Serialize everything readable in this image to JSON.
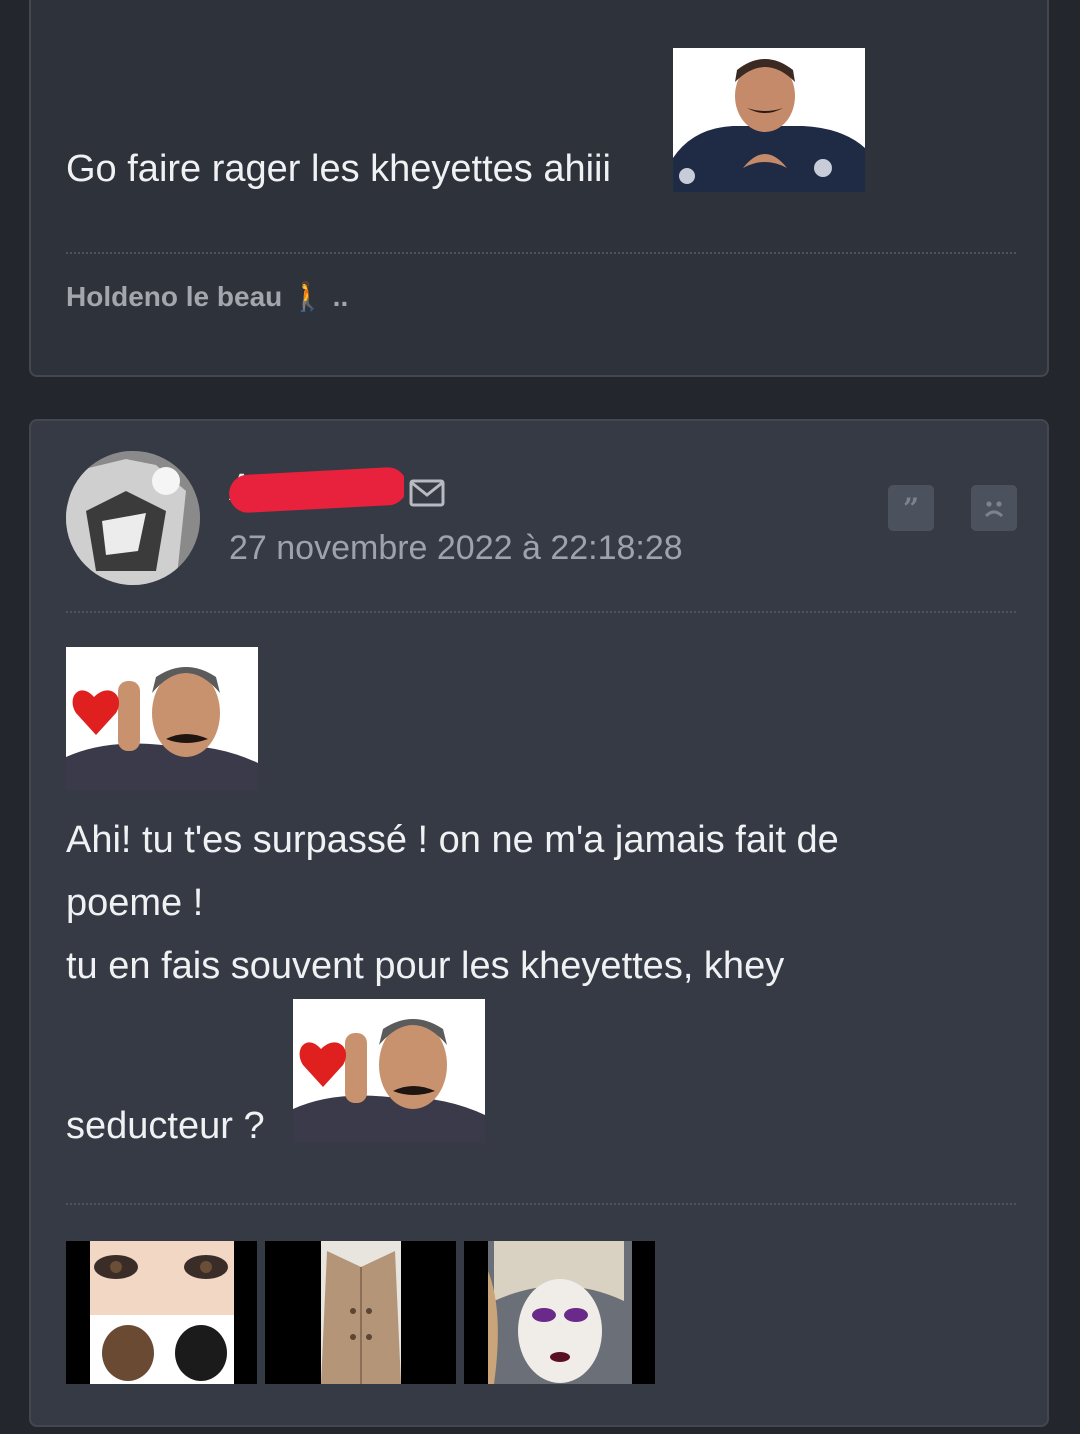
{
  "previous_post": {
    "text": "Go faire rager les kheyettes ahiii",
    "signature": "Holdeno le beau 🚶 .."
  },
  "post": {
    "author": "A",
    "date": "27 novembre 2022 à 22:18:28",
    "quote_icon": "quote-icon",
    "report_icon": "sad-face-icon",
    "lines": [
      "Ahi! tu t'es surpassé ! on ne m'a jamais fait de",
      "poeme !",
      "tu en fais souvent pour les kheyettes, khey",
      "seducteur ?"
    ],
    "attachments": [
      "image-1",
      "image-2",
      "image-3"
    ]
  },
  "colors": {
    "background": "#23262c",
    "card": "#353a45",
    "redaction": "#e8213d"
  }
}
